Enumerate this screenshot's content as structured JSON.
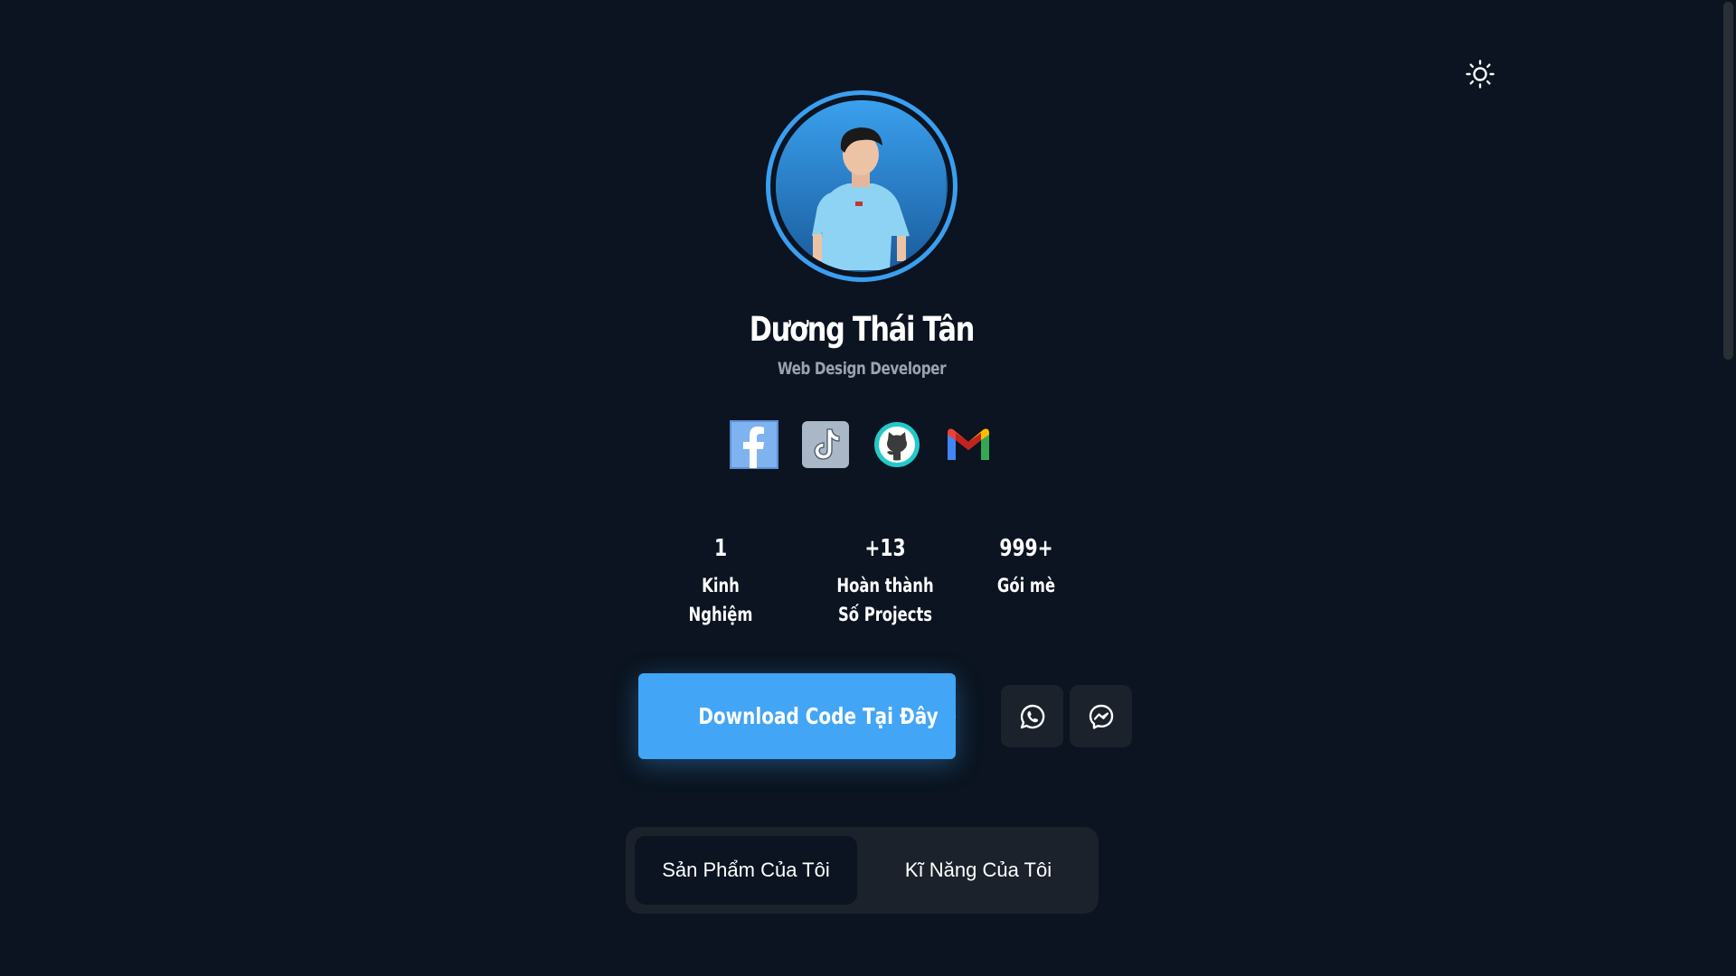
{
  "profile": {
    "name": "Dương Thái Tân",
    "title": "Web Design Developer"
  },
  "socials": [
    {
      "name": "facebook-icon"
    },
    {
      "name": "tiktok-icon"
    },
    {
      "name": "github-icon"
    },
    {
      "name": "gmail-icon"
    }
  ],
  "stats": [
    {
      "value": "1",
      "label_line1": "Kinh Nghiệm",
      "label_line2": ""
    },
    {
      "value": "+13",
      "label_line1": "Hoàn thành",
      "label_line2": "Số Projects"
    },
    {
      "value": "999+",
      "label_line1": "Gói mè",
      "label_line2": ""
    }
  ],
  "actions": {
    "download_label": "Download Code Tại Đây",
    "whatsapp_icon": "whatsapp-icon",
    "messenger_icon": "messenger-icon"
  },
  "tabs": [
    {
      "label": "Sản Phẩm Của Tôi",
      "active": true
    },
    {
      "label": "Kĩ Năng Của Tôi",
      "active": false
    }
  ],
  "colors": {
    "background": "#0b1420",
    "accent": "#42a5f5",
    "ring": "#3a9ff0",
    "card": "#1b222b",
    "muted_text": "#9aa3ad"
  }
}
